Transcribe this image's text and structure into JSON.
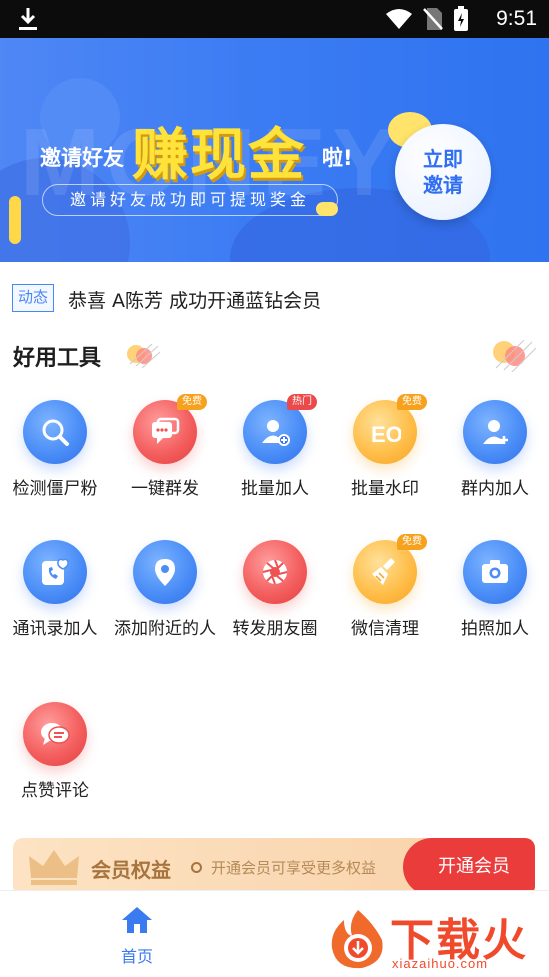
{
  "status_bar": {
    "time": "9:51"
  },
  "banner": {
    "watermark": "MONEY",
    "invite_text": "邀请好友",
    "headline": "赚现金",
    "exclaim": "啦!",
    "subtitle": "邀请好友成功即可提现奖金",
    "cta_line1": "立即",
    "cta_line2": "邀请"
  },
  "notice": {
    "tag": "动态",
    "text": "恭喜 A陈芳 成功开通蓝钻会员"
  },
  "tools_section": {
    "title": "好用工具"
  },
  "tools": [
    {
      "label": "检测僵尸粉",
      "icon": "magnifier-icon",
      "color": "blue",
      "badge": ""
    },
    {
      "label": "一键群发",
      "icon": "chat-bubbles-icon",
      "color": "red",
      "badge": "免费"
    },
    {
      "label": "批量加人",
      "icon": "user-add-icon",
      "color": "blue",
      "badge": "热门"
    },
    {
      "label": "批量水印",
      "icon": "eo-watermark-icon",
      "color": "orange",
      "badge": "免费"
    },
    {
      "label": "群内加人",
      "icon": "user-plus-icon",
      "color": "blue",
      "badge": ""
    },
    {
      "label": "通讯录加人",
      "icon": "contact-phone-icon",
      "color": "blue",
      "badge": ""
    },
    {
      "label": "添加附近的人",
      "icon": "location-pin-icon",
      "color": "blue",
      "badge": ""
    },
    {
      "label": "转发朋友圈",
      "icon": "aperture-icon",
      "color": "red",
      "badge": ""
    },
    {
      "label": "微信清理",
      "icon": "broom-icon",
      "color": "orange",
      "badge": "免费"
    },
    {
      "label": "拍照加人",
      "icon": "camera-icon",
      "color": "blue",
      "badge": ""
    },
    {
      "label": "点赞评论",
      "icon": "comment-icon",
      "color": "red",
      "badge": ""
    }
  ],
  "member": {
    "title": "会员权益",
    "desc": "开通会员可享受更多权益",
    "button": "开通会员"
  },
  "bottom_nav": {
    "home_label": "首页"
  },
  "watermark_logo": {
    "name": "下载火",
    "domain": "xiazaihuo.com"
  },
  "colors": {
    "primary": "#3b7bf0",
    "accent_red": "#eb3c3c",
    "gold": "#a7743d"
  }
}
